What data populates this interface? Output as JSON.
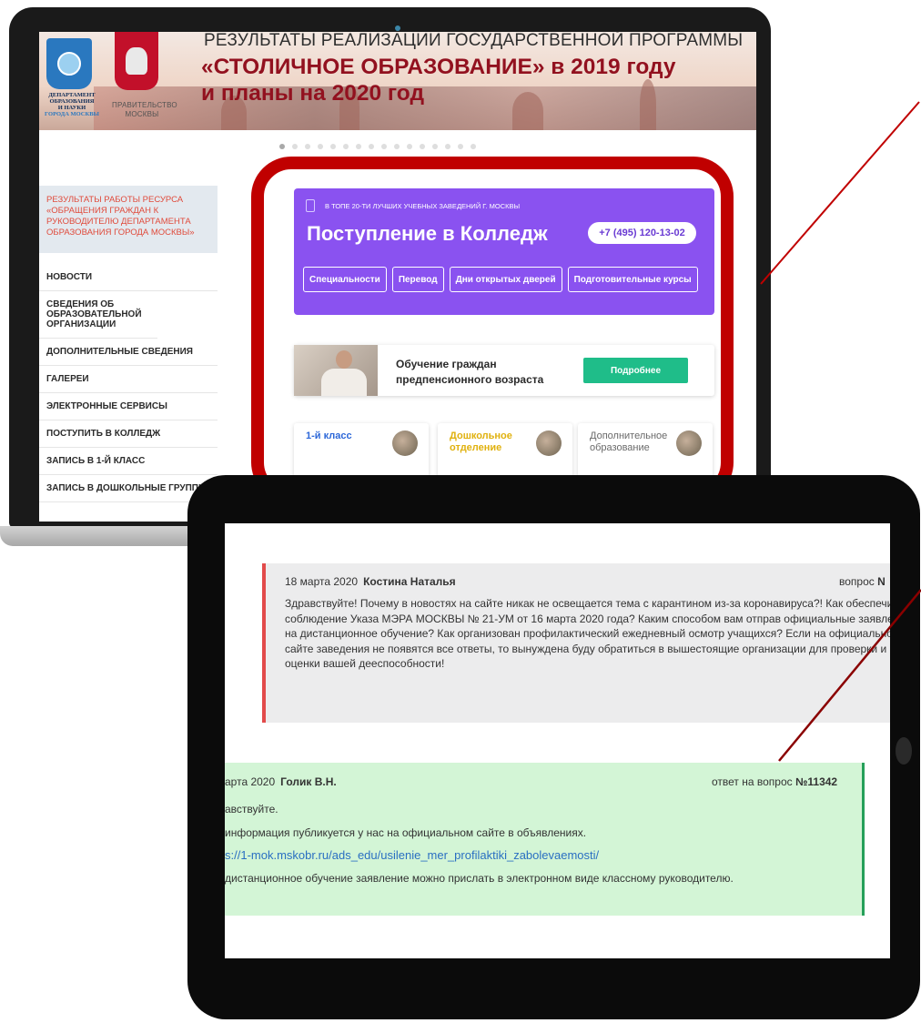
{
  "banner": {
    "line1": "РЕЗУЛЬТАТЫ РЕАЛИЗАЦИИ ГОСУДАРСТВЕННОЙ ПРОГРАММЫ",
    "line2": "«СТОЛИЧНОЕ ОБРАЗОВАНИЕ» в 2019 году",
    "line3": "и планы на 2020 год",
    "dept_logo_text": [
      "ДЕПАРТАМЕНТ",
      "ОБРАЗОВАНИЯ",
      "И НАУКИ",
      "ГОРОДА МОСКВЫ"
    ],
    "gov_logo_text": [
      "ПРАВИТЕЛЬСТВО",
      "МОСКВЫ"
    ]
  },
  "slider": {
    "count": 16,
    "active": 0
  },
  "sidebar": {
    "highlight": "РЕЗУЛЬТАТЫ РАБОТЫ РЕСУРСА «ОБРАЩЕНИЯ ГРАЖДАН К РУКОВОДИТЕЛЮ ДЕПАРТАМЕНТА ОБРАЗОВАНИЯ ГОРОДА МОСКВЫ»",
    "items": [
      {
        "label": "НОВОСТИ"
      },
      {
        "label": "СВЕДЕНИЯ ОБ ОБРАЗОВАТЕЛЬНОЙ ОРГАНИЗАЦИИ"
      },
      {
        "label": "ДОПОЛНИТЕЛЬНЫЕ СВЕДЕНИЯ"
      },
      {
        "label": "ГАЛЕРЕИ"
      },
      {
        "label": "ЭЛЕКТРОННЫЕ СЕРВИСЫ"
      },
      {
        "label": "ПОСТУПИТЬ В КОЛЛЕДЖ"
      },
      {
        "label": "ЗАПИСЬ В 1-Й КЛАСС"
      },
      {
        "label": "ЗАПИСЬ В ДОШКОЛЬНЫЕ ГРУППЫ"
      }
    ]
  },
  "promo": {
    "top_text": "В ТОПЕ 20-ТИ ЛУЧШИХ УЧЕБНЫХ ЗАВЕДЕНИЙ Г. МОСКВЫ",
    "title": "Поступление в Колледж",
    "phone": "+7 (495) 120-13-02",
    "buttons": [
      {
        "label": "Специальности"
      },
      {
        "label": "Перевод"
      },
      {
        "label": "Дни открытых дверей"
      },
      {
        "label": "Подготовительные курсы"
      }
    ]
  },
  "senior": {
    "line1": "Обучение граждан",
    "line2": "предпенсионного возраста",
    "button": "Подробнее"
  },
  "cards": [
    {
      "title": [
        "1-й класс"
      ]
    },
    {
      "title": [
        "Дошкольное",
        "отделение"
      ]
    },
    {
      "title": [
        "Дополнительное",
        "образование"
      ]
    }
  ],
  "question": {
    "date": "18 марта 2020",
    "author": "Костина Наталья",
    "label": "вопрос",
    "number": "N",
    "text": "Здравствуйте! Почему в новостях на сайте никак не освещается тема с карантином из-за коронавируса?! Как обеспечиваете соблюдение Указа МЭРА МОСКВЫ № 21-УМ от 16 марта 2020 года? Каким способом вам отправ официальные заявления на дистанционное обучение? Как организован профилактический ежедневный осмотр учащихся? Если на официальном сайте заведения не появятся все ответы, то вынуждена буду обратиться в вышестоящие организации для проверки и оценки вашей дееспособности!"
  },
  "answer": {
    "date": "арта 2020",
    "author": "Голик В.Н.",
    "label": "ответ на вопрос",
    "number": "№11342",
    "greeting": "авствуйте.",
    "line1": "информация публикуется у нас на официальном сайте в объявлениях.",
    "link": "s://1-mok.mskobr.ru/ads_edu/usilenie_mer_profilaktiki_zabolevaemosti/",
    "line2": "дистанционное обучение заявление можно прислать в электронном виде классному руководителю."
  },
  "colors": {
    "frame_red": "#c00000",
    "promo_purple": "#8a52f0",
    "senior_green": "#1fbd89",
    "banner_title": "#92111f",
    "sidebar_highlight": "#e04b3c",
    "question_border": "#e24b4b",
    "answer_bg": "#d3f5d6",
    "answer_border": "#26a05a",
    "link_blue": "#2a6fc2"
  }
}
